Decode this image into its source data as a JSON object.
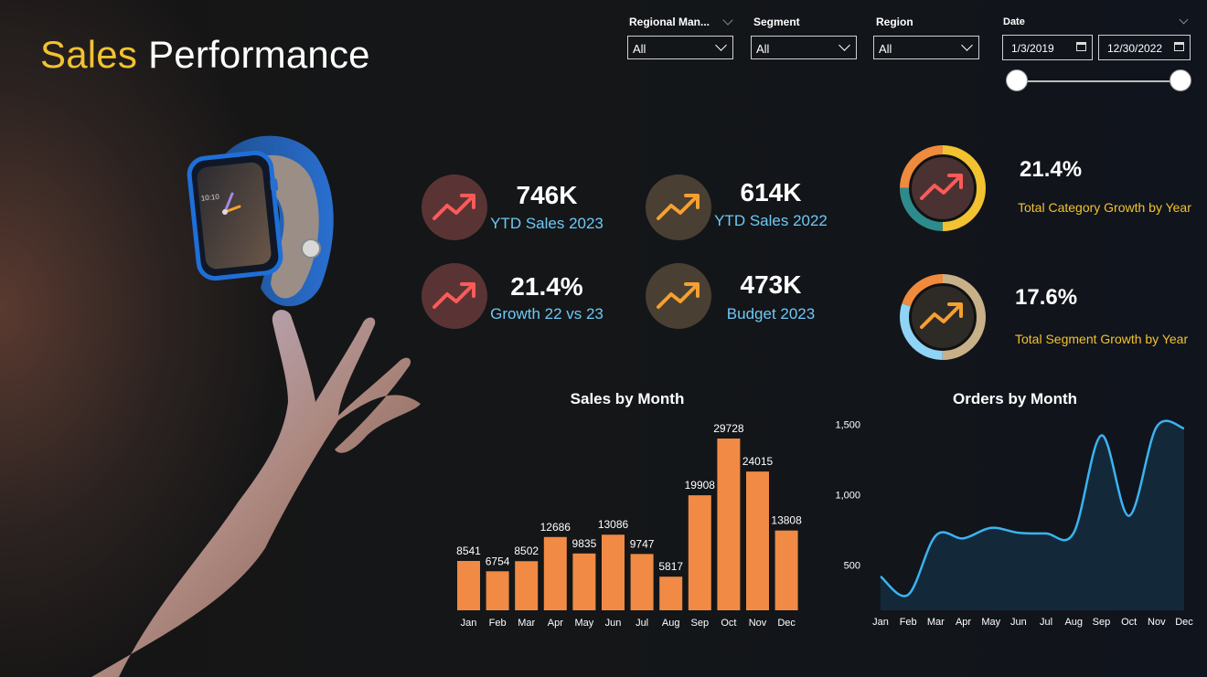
{
  "header": {
    "title_part1": "Sales",
    "title_part2": "Performance"
  },
  "filters": {
    "regional_manager": {
      "label": "Regional Man...",
      "value": "All"
    },
    "segment": {
      "label": "Segment",
      "value": "All"
    },
    "region": {
      "label": "Region",
      "value": "All"
    },
    "date": {
      "label": "Date",
      "start": "1/3/2019",
      "end": "12/30/2022",
      "range_selected": [
        0,
        1
      ]
    }
  },
  "kpis": [
    {
      "value": "746K",
      "label": "YTD Sales 2023",
      "icon": "trend-up-icon",
      "color": "#ff5a5a",
      "bg": "#5a3434"
    },
    {
      "value": "614K",
      "label": "YTD Sales 2022",
      "icon": "trend-up-icon",
      "color": "#f5a030",
      "bg": "#4a3f33"
    },
    {
      "value": "21.4%",
      "label": "Growth 22 vs 23",
      "icon": "trend-up-icon",
      "color": "#ff5a5a",
      "bg": "#5a3434"
    },
    {
      "value": "473K",
      "label": "Budget 2023",
      "icon": "trend-up-icon",
      "color": "#f5a030",
      "bg": "#4a3f33"
    }
  ],
  "rings": [
    {
      "value": "21.4%",
      "label": "Total Category Growth by Year",
      "icon": "trend-up-icon",
      "icon_color": "#ff5a5a",
      "inner_bg": "#4a3232",
      "segments": [
        {
          "color": "#f2c230",
          "share": 0.5
        },
        {
          "color": "#2e8b8b",
          "share": 0.25
        },
        {
          "color": "#f08a3c",
          "share": 0.25
        }
      ]
    },
    {
      "value": "17.6%",
      "label": "Total Segment Growth by Year",
      "icon": "trend-up-icon",
      "icon_color": "#f5a030",
      "inner_bg": "#2e2a26",
      "segments": [
        {
          "color": "#c8b088",
          "share": 0.5
        },
        {
          "color": "#8fd3f5",
          "share": 0.3
        },
        {
          "color": "#f08a3c",
          "share": 0.2
        }
      ]
    }
  ],
  "chart_data": [
    {
      "type": "bar",
      "title": "Sales by Month",
      "categories": [
        "Jan",
        "Feb",
        "Mar",
        "Apr",
        "May",
        "Jun",
        "Jul",
        "Aug",
        "Sep",
        "Oct",
        "Nov",
        "Dec"
      ],
      "values": [
        8541,
        6754,
        8502,
        12686,
        9835,
        13086,
        9747,
        5817,
        19908,
        29728,
        24015,
        13808
      ],
      "color": "#f08a44",
      "data_labels": true
    },
    {
      "type": "area",
      "title": "Orders by Month",
      "categories": [
        "Jan",
        "Feb",
        "Mar",
        "Apr",
        "May",
        "Jun",
        "Jul",
        "Aug",
        "Sep",
        "Oct",
        "Nov",
        "Dec"
      ],
      "values": [
        420,
        290,
        710,
        690,
        765,
        730,
        725,
        730,
        1420,
        850,
        1480,
        1470
      ],
      "ylim": [
        180,
        1560
      ],
      "yticks": [
        500,
        1000,
        1500
      ],
      "ytick_labels": [
        "500",
        "1,000",
        "1,500"
      ],
      "line_color": "#3ab4f2",
      "fill_color": "#13293a"
    }
  ]
}
